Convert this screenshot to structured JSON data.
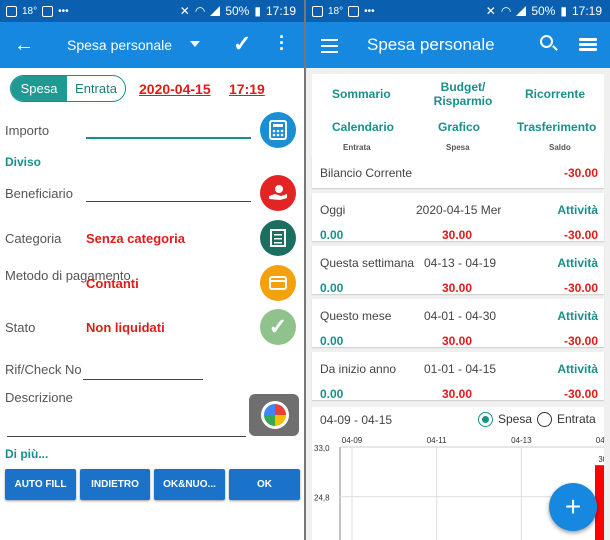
{
  "status_left": {
    "time": "17:19",
    "battery": "50%",
    "temp": "18°"
  },
  "status_right": {
    "time": "17:19",
    "battery": "50%",
    "temp": "18°"
  },
  "left": {
    "title": "Spesa personale",
    "toggle": {
      "active": "Spesa",
      "inactive": "Entrata"
    },
    "date": "2020-04-15",
    "time": "17:19",
    "fields": {
      "amount_label": "Importo",
      "split_label": "Diviso",
      "payee_label": "Beneficiario",
      "category_label": "Categoria",
      "category_value": "Senza categoria",
      "payment_label": "Metodo di pagamento",
      "payment_value": "Contanti",
      "state_label": "Stato",
      "state_value": "Non liquidati",
      "check_label": "Rif/Check No",
      "description_label": "Descrizione"
    },
    "more_label": "Di più...",
    "buttons": [
      "AUTO FILL",
      "INDIETRO",
      "OK&NUO...",
      "OK"
    ],
    "colors": {
      "accent": "#1a8f8a",
      "red": "#e11a1a",
      "appbar": "#1688df"
    }
  },
  "right": {
    "title": "Spesa personale",
    "menu": [
      "Sommario",
      "Budget/ Risparmio",
      "Ricorrente",
      "Calendario",
      "Grafico",
      "Trasferimento"
    ],
    "col_heads": [
      "Entrata",
      "Spesa",
      "Saldo"
    ],
    "balance": {
      "label": "Bilancio Corrente",
      "value": "-30.00"
    },
    "rows": [
      {
        "label": "Oggi",
        "range": "2020-04-15 Mer",
        "action": "Attività",
        "income": "0.00",
        "expense": "30.00",
        "balance": "-30.00"
      },
      {
        "label": "Questa settimana",
        "range": "04-13 - 04-19",
        "action": "Attività",
        "income": "0.00",
        "expense": "30.00",
        "balance": "-30.00"
      },
      {
        "label": "Questo mese",
        "range": "04-01 - 04-30",
        "action": "Attività",
        "income": "0.00",
        "expense": "30.00",
        "balance": "-30.00"
      },
      {
        "label": "Da inizio anno",
        "range": "01-01 - 04-15",
        "action": "Attività",
        "income": "0.00",
        "expense": "30.00",
        "balance": "-30.00"
      }
    ],
    "chart": {
      "range": "04-09 - 04-15",
      "radio_spesa": "Spesa",
      "radio_entrata": "Entrata",
      "x_ticks": [
        "04-09",
        "04-11",
        "04-13",
        "04-15"
      ],
      "y_ticks": [
        "33,0",
        "24,8",
        "16,5"
      ],
      "bar_label": "30,0"
    }
  },
  "chart_data": {
    "type": "bar",
    "categories": [
      "04-09",
      "04-10",
      "04-11",
      "04-12",
      "04-13",
      "04-14",
      "04-15"
    ],
    "values": [
      0,
      0,
      0,
      0,
      0,
      0,
      30.0
    ],
    "ylim": [
      16.5,
      33.0
    ]
  }
}
